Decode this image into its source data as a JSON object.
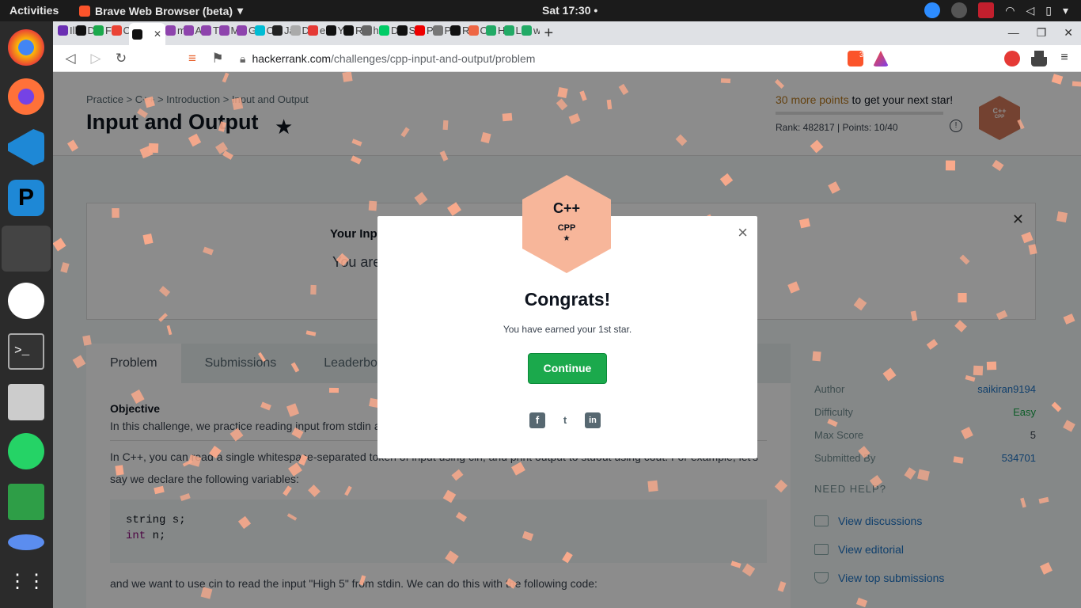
{
  "topbar": {
    "activities": "Activities",
    "app": "Brave Web Browser (beta)",
    "clock": "Sat 17:30"
  },
  "browser": {
    "tabs": [
      "Ill",
      "D",
      "Fi",
      "C",
      "",
      "m",
      "A",
      "Tl",
      "M",
      "G",
      "Cc",
      "Ja",
      "D",
      "el",
      "Yc",
      "Re",
      "hi",
      "Da",
      "St",
      "P",
      "Pl",
      "Re",
      "O",
      "H",
      "Lc",
      "w"
    ],
    "url_host": "hackerrank.com",
    "url_path": "/challenges/cpp-input-and-output/problem",
    "shield_count": "3"
  },
  "page": {
    "crumbs": "Practice  >  C++  >  Introduction  >  Input and Output",
    "title": "Input and Output",
    "points_highlight": "30 more points",
    "points_rest": " to get your next star!",
    "progress": 0.0,
    "rank": "Rank: 482817  |  Points: 10/40",
    "badge_label": "C++",
    "badge_sub": "CPP",
    "banner_title": "Your Input",
    "banner_text": "You are ... mode.",
    "tabs": [
      "Problem",
      "Submissions",
      "Leaderboard"
    ],
    "objective": "Objective",
    "p1": "In this challenge, we practice reading input from stdin and printing output to stdout.",
    "p2": "In C++, you can read a single whitespace-separated token of input using cin, and print output to stdout using cout. For example, let's say we declare the following variables:",
    "code1": "string s;",
    "code2_kw": "int",
    "code2": " n;",
    "p3": "and we want to use cin to read the input \"High 5\" from stdin. We can do this with the following code:",
    "side": {
      "rows": [
        {
          "label": "Author",
          "value": "saikiran9194"
        },
        {
          "label": "Difficulty",
          "value": "Easy"
        },
        {
          "label": "Max Score",
          "value": "5"
        },
        {
          "label": "Submitted By",
          "value": "534701"
        }
      ],
      "need_help": "NEED HELP?",
      "links": [
        "View discussions",
        "View editorial",
        "View top submissions"
      ]
    }
  },
  "modal": {
    "badge_top": "C++",
    "badge_name": "CPP",
    "badge_star": "★",
    "title": "Congrats!",
    "subtitle": "You have earned your 1st star.",
    "button": "Continue",
    "close": "×",
    "social": [
      "f",
      "t",
      "in"
    ]
  },
  "colors": {
    "accent": "#1ba94c",
    "confetti": "#f9a98b",
    "badge": "#f7b69a"
  }
}
